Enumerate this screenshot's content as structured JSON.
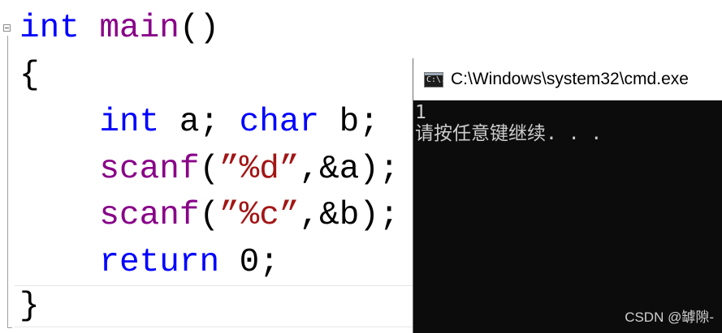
{
  "editor": {
    "lines": [
      [
        {
          "t": "int",
          "c": "kw"
        },
        {
          "t": " ",
          "c": "pl"
        },
        {
          "t": "main",
          "c": "fn"
        },
        {
          "t": "()",
          "c": "pl"
        }
      ],
      [
        {
          "t": "{",
          "c": "pl"
        }
      ],
      [
        {
          "t": "    ",
          "c": "pl"
        },
        {
          "t": "int",
          "c": "kw"
        },
        {
          "t": " a; ",
          "c": "pl"
        },
        {
          "t": "char",
          "c": "kw"
        },
        {
          "t": " b;",
          "c": "pl"
        }
      ],
      [
        {
          "t": "    ",
          "c": "pl"
        },
        {
          "t": "scanf",
          "c": "fn"
        },
        {
          "t": "(",
          "c": "pl"
        },
        {
          "t": "”%d”",
          "c": "str"
        },
        {
          "t": ",&a);",
          "c": "pl"
        }
      ],
      [
        {
          "t": "    ",
          "c": "pl"
        },
        {
          "t": "scanf",
          "c": "fn"
        },
        {
          "t": "(",
          "c": "pl"
        },
        {
          "t": "”%c”",
          "c": "str"
        },
        {
          "t": ",&b);",
          "c": "pl"
        }
      ],
      [
        {
          "t": "    ",
          "c": "pl"
        },
        {
          "t": "return",
          "c": "kw"
        },
        {
          "t": " 0;",
          "c": "pl"
        }
      ],
      [
        {
          "t": "}",
          "c": "pl"
        }
      ]
    ]
  },
  "console": {
    "title": "C:\\Windows\\system32\\cmd.exe",
    "icon_text": "C:\\.",
    "output": [
      "1",
      "请按任意键继续. . ."
    ]
  },
  "watermark": "CSDN @罅隙-",
  "colors": {
    "keyword": "#0000ff",
    "function": "#880088",
    "string": "#a31515",
    "console_bg": "#0c0c0c",
    "console_text": "#cccccc"
  }
}
